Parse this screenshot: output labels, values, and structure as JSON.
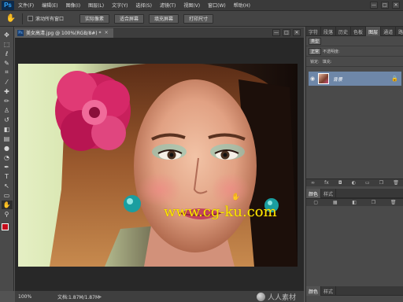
{
  "app": {
    "logo": "Ps"
  },
  "menu": [
    "文件(F)",
    "编辑(E)",
    "图像(I)",
    "图层(L)",
    "文字(Y)",
    "选择(S)",
    "滤镜(T)",
    "视图(V)",
    "窗口(W)",
    "帮助(H)"
  ],
  "window_controls": [
    "—",
    "□",
    "✕"
  ],
  "options": {
    "tool_icon": "hand-icon",
    "scroll_all_label": "滚动所有窗口",
    "buttons": [
      "实际像素",
      "适合屏幕",
      "填充屏幕",
      "打印尺寸"
    ]
  },
  "tools": [
    "move-icon",
    "marquee-icon",
    "lasso-icon",
    "quick-select-icon",
    "crop-icon",
    "eyedropper-icon",
    "healing-icon",
    "brush-icon",
    "stamp-icon",
    "history-brush-icon",
    "eraser-icon",
    "gradient-icon",
    "blur-icon",
    "dodge-icon",
    "pen-icon",
    "type-icon",
    "path-select-icon",
    "shape-icon",
    "hand-icon",
    "zoom-icon"
  ],
  "tool_glyphs": [
    "✥",
    "⬚",
    "ℓ",
    "✎",
    "⌗",
    "⁄",
    "✚",
    "✏",
    "♙",
    "↺",
    "◧",
    "▤",
    "●",
    "◔",
    "✒",
    "T",
    "↖",
    "▭",
    "✋",
    "⚲"
  ],
  "colors": {
    "foreground": "#c40b1b",
    "background": "#ffffff",
    "accent": "#31a8ff",
    "watermark": "#ffe600"
  },
  "document": {
    "tab_title": "美女高清.jpg @ 100%(RGB/8#) *",
    "close": "×",
    "doc_controls": [
      "—",
      "□",
      "✕"
    ]
  },
  "canvas": {
    "watermark": "www.cg-ku.com"
  },
  "status": {
    "zoom": "100%",
    "doc_size": "文档:1.87M/1.87M",
    "brand": "人人素材"
  },
  "panels": {
    "top_tabs": [
      "字符",
      "段落",
      "历史",
      "色板",
      "图层",
      "通道",
      "路径",
      "调整"
    ],
    "active_tab_index": 4,
    "layers": {
      "kind": "类型",
      "blend": "正常",
      "opacity_label": "不透明度:",
      "lock_label": "锁定:",
      "fill_label": "填充:",
      "background_layer": "背景"
    },
    "mid_tabs": [
      "颜色",
      "样式"
    ],
    "bottom_tabs": [
      "颜色",
      "样式"
    ]
  }
}
